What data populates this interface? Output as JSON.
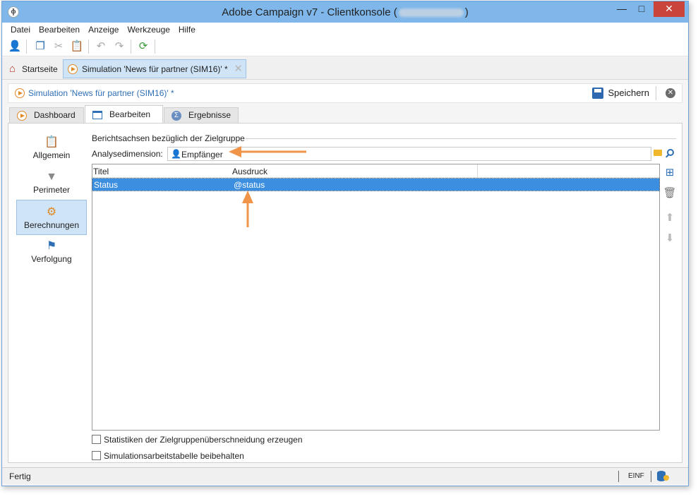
{
  "window": {
    "title_prefix": "Adobe Campaign v7 - Clientkonsole (",
    "title_suffix": ")",
    "buttons": {
      "minimize": "—",
      "maximize": "□",
      "close": "✕"
    }
  },
  "menu": [
    "Datei",
    "Bearbeiten",
    "Anzeige",
    "Werkzeuge",
    "Hilfe"
  ],
  "toolbar": {
    "icons": [
      "new-recipient-icon",
      "copy-icon",
      "cut-icon",
      "paste-icon",
      "undo-icon",
      "redo-icon",
      "refresh-icon"
    ]
  },
  "doc_tabs": {
    "home_label": "Startseite",
    "active_label": "Simulation 'News für partner (SIM16)' *",
    "close_glyph": "✕"
  },
  "doc_header": {
    "title": "Simulation 'News für partner (SIM16)' *",
    "save_label": "Speichern"
  },
  "sub_tabs": [
    "Dashboard",
    "Bearbeiten",
    "Ergebnisse"
  ],
  "active_sub_tab": "Bearbeiten",
  "side_nav": [
    {
      "label": "Allgemein",
      "icon": "clipboard-icon"
    },
    {
      "label": "Perimeter",
      "icon": "filter-icon"
    },
    {
      "label": "Berechnungen",
      "icon": "gear-icon",
      "active": true
    },
    {
      "label": "Verfolgung",
      "icon": "tracking-icon"
    }
  ],
  "form": {
    "section_title": "Berichtsachsen bezüglich der Zielgruppe",
    "dimension_label": "Analysedimension:",
    "dimension_value": "Empfänger"
  },
  "grid": {
    "columns": [
      "Titel",
      "Ausdruck"
    ],
    "rows": [
      {
        "titel": "Status",
        "ausdruck": "@status"
      }
    ]
  },
  "checkboxes": [
    {
      "label": "Statistiken der Zielgruppenüberschneidung erzeugen",
      "checked": false
    },
    {
      "label": "Simulationsarbeitstabelle beibehalten",
      "checked": false
    }
  ],
  "status_bar": {
    "text": "Fertig",
    "mode": "EINF"
  },
  "colors": {
    "accent": "#3b8ee0",
    "annotation_arrow": "#f0944a",
    "titlebar": "#7fb7ea"
  }
}
